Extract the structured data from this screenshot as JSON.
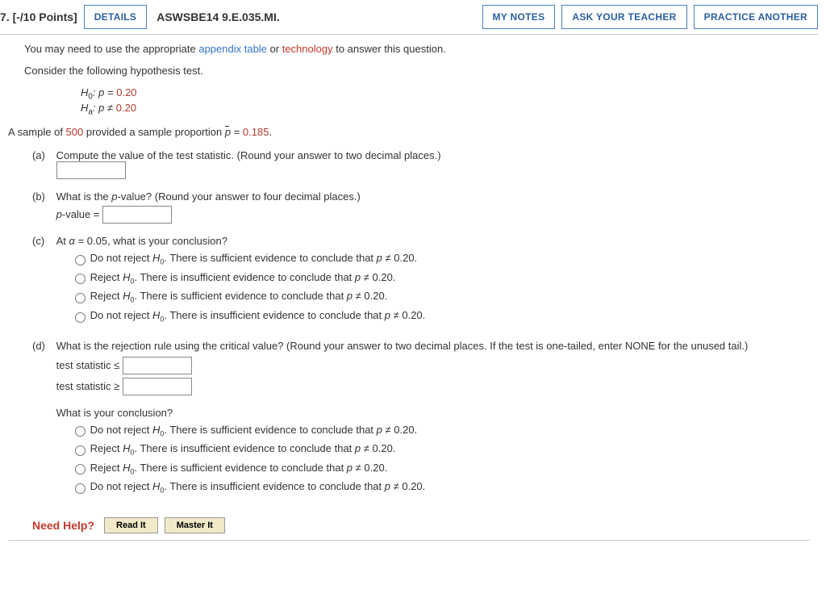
{
  "header": {
    "points": "7. [-/10 Points]",
    "details": "DETAILS",
    "source": "ASWSBE14 9.E.035.MI.",
    "my_notes": "MY NOTES",
    "ask_teacher": "ASK YOUR TEACHER",
    "practice": "PRACTICE ANOTHER"
  },
  "intro": {
    "line1a": "You may need to use the appropriate ",
    "link1": "appendix table",
    "line1b": " or ",
    "link2": "technology",
    "line1c": " to answer this question.",
    "line2": "Consider the following hypothesis test."
  },
  "hypotheses": {
    "h0_pre": "H",
    "h0_sub": "0",
    "h0_txt": ": p = ",
    "h0_val": "0.20",
    "ha_pre": "H",
    "ha_sub": "a",
    "ha_txt": ": p ≠ ",
    "ha_val": "0.20"
  },
  "sample": {
    "pre": "A sample of ",
    "n": "500",
    "mid": " provided a sample proportion ",
    "pbar": "p",
    "eq": " = ",
    "val": "0.185",
    "end": "."
  },
  "parts": {
    "a": {
      "label": "(a)",
      "prompt": "Compute the value of the test statistic. (Round your answer to two decimal places.)"
    },
    "b": {
      "label": "(b)",
      "prompt": "What is the p-value? (Round your answer to four decimal places.)",
      "pvalue_label": "p-value = "
    },
    "c": {
      "label": "(c)",
      "prompt": "At α = 0.05, what is your conclusion?",
      "opts": [
        "Do not reject H0. There is sufficient evidence to conclude that p ≠ 0.20.",
        "Reject H0. There is insufficient evidence to conclude that p ≠ 0.20.",
        "Reject H0. There is sufficient evidence to conclude that p ≠ 0.20.",
        "Do not reject H0. There is insufficient evidence to conclude that p ≠ 0.20."
      ]
    },
    "d": {
      "label": "(d)",
      "prompt": "What is the rejection rule using the critical value? (Round your answer to two decimal places. If the test is one-tailed, enter NONE for the unused tail.)",
      "rule_le": "test statistic ≤ ",
      "rule_ge": "test statistic ≥ ",
      "conclusion_q": "What is your conclusion?",
      "opts": [
        "Do not reject H0. There is sufficient evidence to conclude that p ≠ 0.20.",
        "Reject H0. There is insufficient evidence to conclude that p ≠ 0.20.",
        "Reject H0. There is sufficient evidence to conclude that p ≠ 0.20.",
        "Do not reject H0. There is insufficient evidence to conclude that p ≠ 0.20."
      ]
    }
  },
  "help": {
    "label": "Need Help?",
    "read": "Read It",
    "master": "Master It"
  }
}
